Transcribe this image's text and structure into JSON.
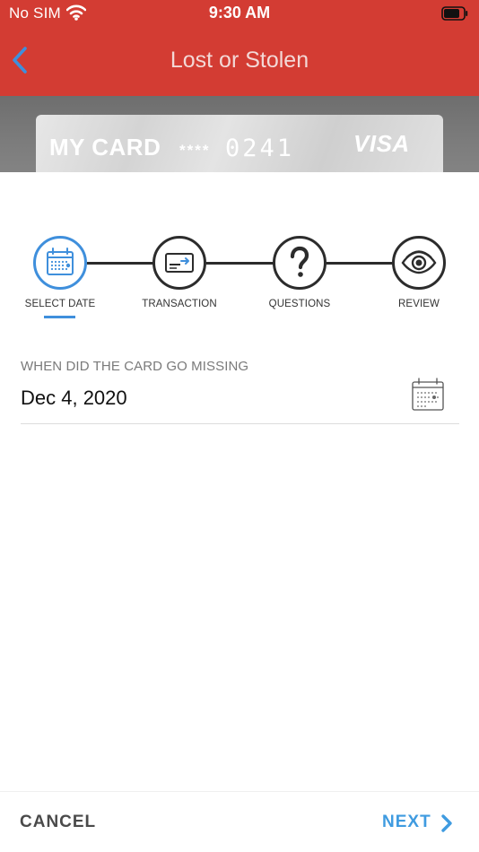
{
  "status_bar": {
    "carrier": "No SIM",
    "time": "9:30 AM"
  },
  "nav": {
    "title": "Lost or Stolen",
    "back_icon": "chevron-left-icon"
  },
  "card": {
    "name": "MY CARD",
    "masked": "****",
    "last_digits": "0241",
    "brand": "VISA"
  },
  "steps": [
    {
      "label": "SELECT DATE",
      "icon": "calendar-icon",
      "active": true
    },
    {
      "label": "TRANSACTION",
      "icon": "credit-card-icon",
      "active": false
    },
    {
      "label": "QUESTIONS",
      "icon": "question-mark-icon",
      "active": false
    },
    {
      "label": "REVIEW",
      "icon": "eye-icon",
      "active": false
    }
  ],
  "date_field": {
    "label": "WHEN DID THE CARD GO MISSING",
    "value": "Dec 4, 2020",
    "icon": "calendar-icon"
  },
  "footer": {
    "cancel": "CANCEL",
    "next": "NEXT"
  },
  "colors": {
    "header": "#d33c33",
    "accent": "#3f8fdc",
    "next": "#3f9be0"
  }
}
